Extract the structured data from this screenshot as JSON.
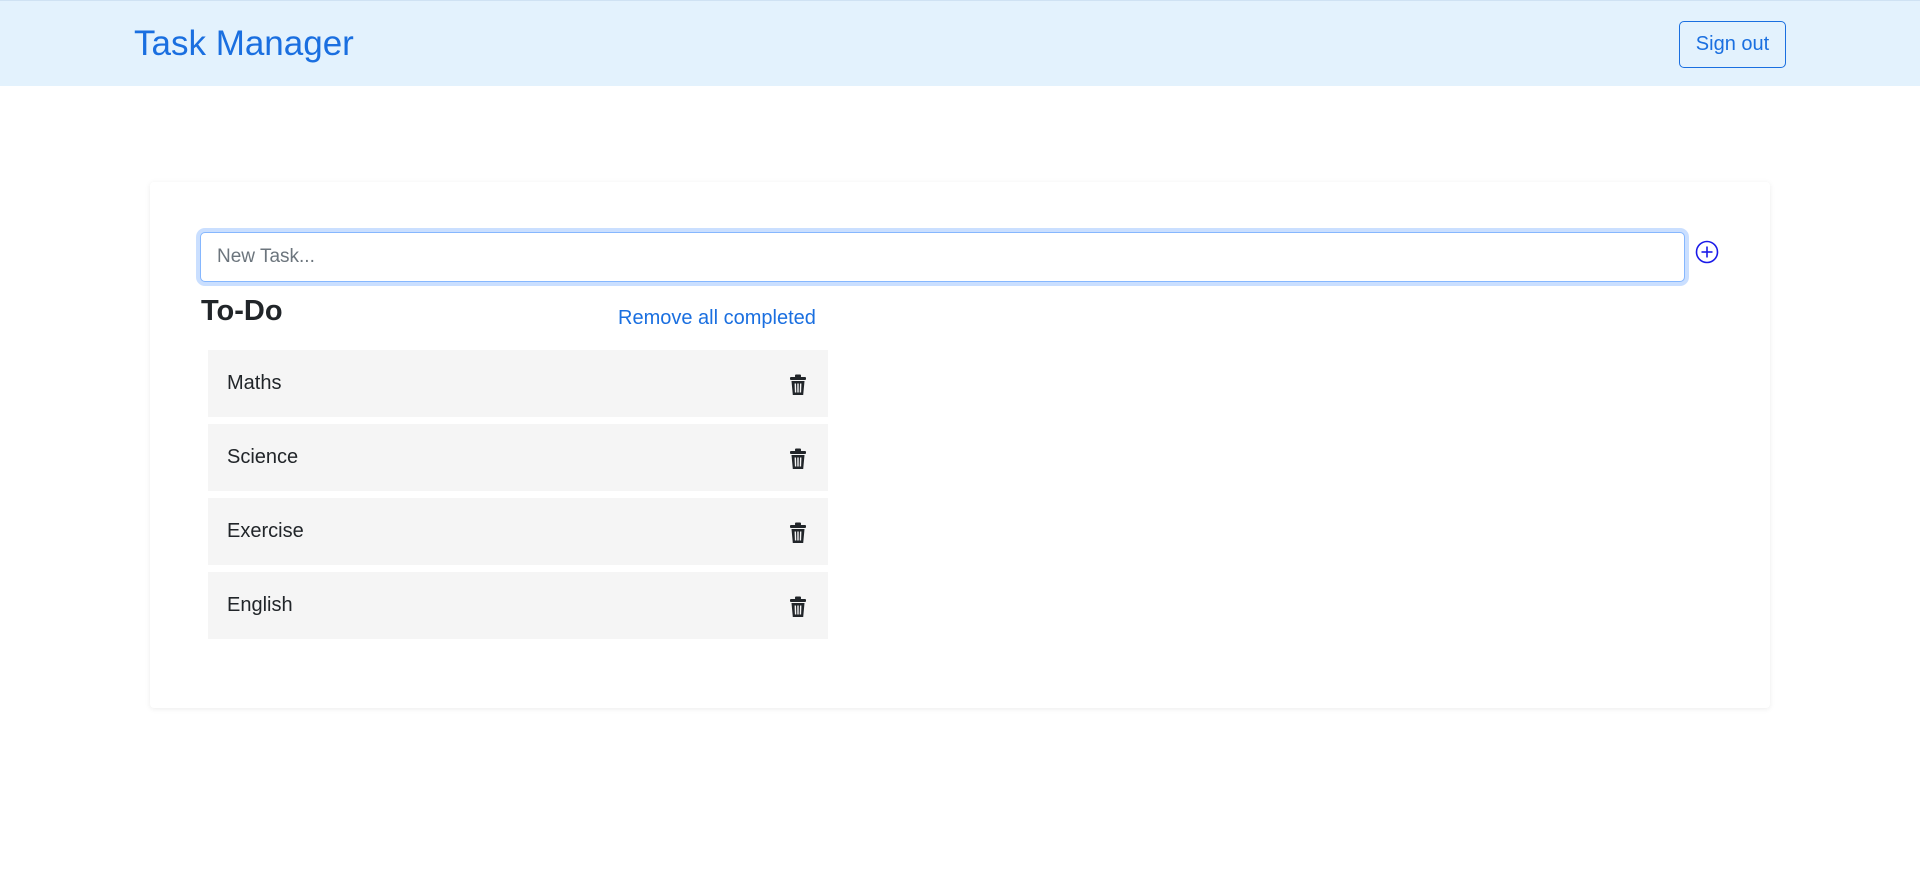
{
  "header": {
    "title": "Task Manager",
    "sign_out_label": "Sign out"
  },
  "composer": {
    "placeholder": "New Task...",
    "value": "",
    "add_icon": "plus-circle-icon"
  },
  "todo": {
    "heading": "To-Do",
    "remove_completed_label": "Remove all completed",
    "items": [
      {
        "label": "Maths",
        "icon": "trash-icon"
      },
      {
        "label": "Science",
        "icon": "trash-icon"
      },
      {
        "label": "Exercise",
        "icon": "trash-icon"
      },
      {
        "label": "English",
        "icon": "trash-icon"
      }
    ]
  },
  "colors": {
    "accent": "#1a6fe0",
    "navbar_bg": "#e3f2fd",
    "add_icon": "#1a1ae8",
    "item_bg": "#f5f5f5"
  }
}
